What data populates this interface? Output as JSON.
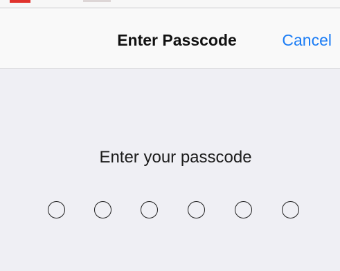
{
  "nav": {
    "title": "Enter Passcode",
    "cancel_label": "Cancel"
  },
  "prompt": "Enter your passcode",
  "passcode": {
    "length": 6,
    "entered": 0
  },
  "colors": {
    "accent": "#1a7cf5",
    "background": "#efeff4",
    "nav_background": "#f9f9f9"
  }
}
